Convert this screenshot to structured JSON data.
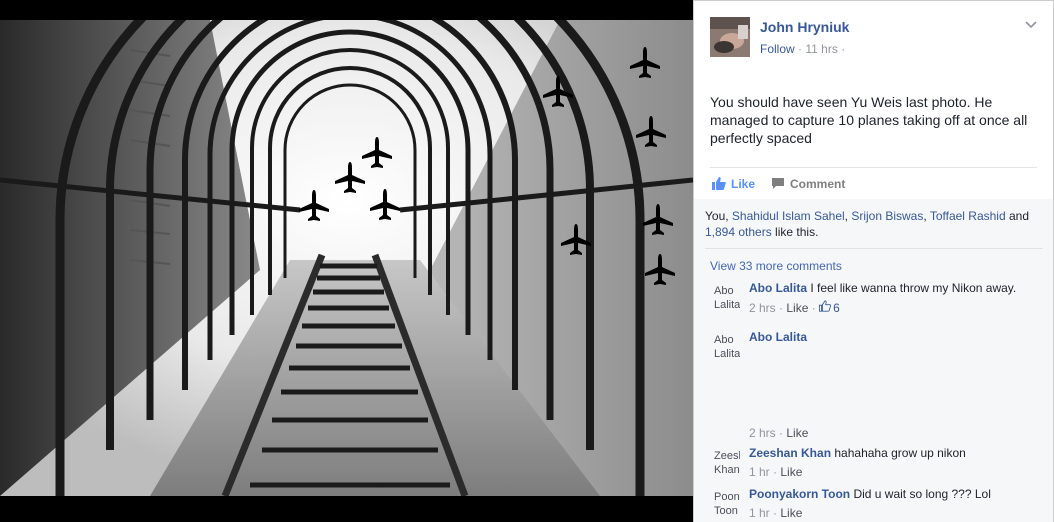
{
  "post": {
    "author": "John Hryniuk",
    "follow_label": "Follow",
    "separator": "·",
    "time": "11 hrs",
    "separator2": "·",
    "text": "You should have seen Yu Weis last photo. He managed to capture 10 planes taking off at once all perfectly spaced",
    "like_label": "Like",
    "comment_label": "Comment"
  },
  "likes": {
    "you": "You, ",
    "names": [
      "Shahidul Islam Sahel",
      "Srijon Biswas",
      "Toffael Rashid"
    ],
    "and": " and ",
    "others": "1,894 others",
    "tail": " like this."
  },
  "view_more": "View 33 more comments",
  "comments": [
    {
      "avatar_alt": "Abo Lalita",
      "name": "Abo Lalita",
      "text": "I feel like wanna throw my Nikon away.",
      "time": "2 hrs",
      "sep": "·",
      "like": "Like",
      "sep2": "·",
      "likes_count": "6"
    },
    {
      "avatar_alt": "Abo Lalita",
      "name": "Abo Lalita",
      "text": "",
      "time": "2 hrs",
      "sep": "·",
      "like": "Like"
    },
    {
      "avatar_alt": "Zeeshan Khan",
      "name": "Zeeshan Khan",
      "text": "hahahaha grow up nikon",
      "time": "1 hr",
      "sep": "·",
      "like": "Like"
    },
    {
      "avatar_alt": "Poonyakorn Toon",
      "name": "Poonyakorn Toon",
      "text": "Did u wait so long ??? Lol",
      "time": "1 hr",
      "sep": "·",
      "like": "Like"
    }
  ],
  "colors": {
    "link": "#365899",
    "accent": "#5890ff",
    "panel_bg": "#f6f7f9"
  },
  "icons": {
    "chevron": "chevron-down-icon",
    "like": "thumbs-up-icon",
    "comment": "comment-bubble-icon"
  }
}
